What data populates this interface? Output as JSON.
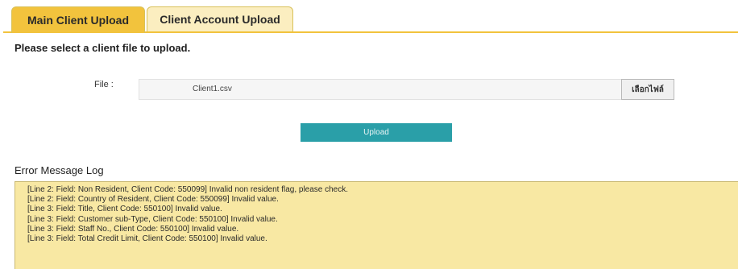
{
  "tabs": [
    {
      "label": "Main Client Upload",
      "active": true
    },
    {
      "label": "Client Account Upload",
      "active": false
    }
  ],
  "prompt": "Please select a client file to upload.",
  "file": {
    "label": "File :",
    "value": "Client1.csv",
    "browse_label": "เลือกไฟล์"
  },
  "upload_label": "Upload",
  "log": {
    "title": "Error Message Log",
    "lines": [
      "[Line 2: Field: Non Resident, Client Code: 550099] Invalid non resident flag, please check.",
      "[Line 2: Field: Country of Resident, Client Code: 550099] Invalid value.",
      "[Line 3: Field: Title, Client Code: 550100] Invalid value.",
      "[Line 3: Field: Customer sub-Type, Client Code: 550100] Invalid value.",
      "[Line 3: Field: Staff No., Client Code: 550100] Invalid value.",
      "[Line 3: Field: Total Credit Limit, Client Code: 550100] Invalid value."
    ]
  },
  "colors": {
    "tab_active": "#f2c33d",
    "tab_inactive": "#fbeec0",
    "upload_button": "#2a9fa8",
    "log_background": "#f8e8a3"
  }
}
